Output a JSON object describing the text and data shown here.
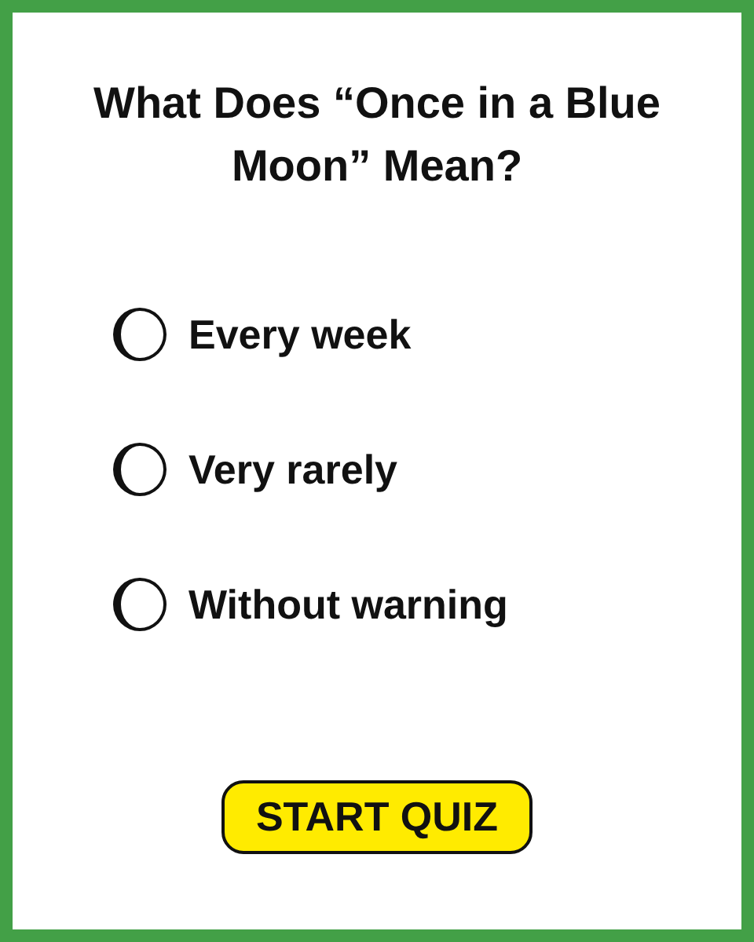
{
  "title": "What Does “Once in a Blue Moon” Mean?",
  "options": [
    {
      "label": "Every week",
      "selected": false
    },
    {
      "label": "Very rarely",
      "selected": false
    },
    {
      "label": "Without warning",
      "selected": false
    }
  ],
  "button": "START QUIZ"
}
